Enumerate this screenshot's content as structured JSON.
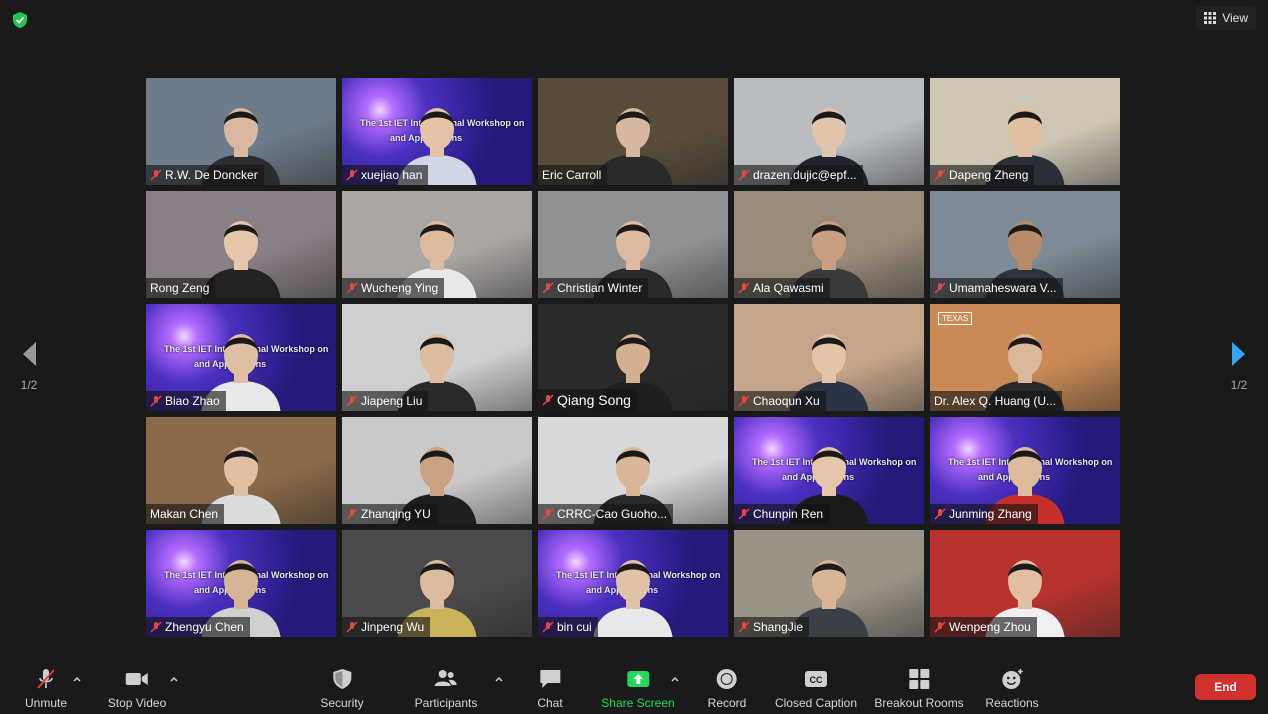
{
  "top_bar": {
    "view_label": "View"
  },
  "participants": [
    {
      "name": "R.W. De Doncker",
      "muted": true,
      "bg": "#6e7b8a",
      "skin": "#d9b8a2",
      "shirt": "#2c2c2c",
      "slide": false
    },
    {
      "name": "xuejiao han",
      "muted": true,
      "bg": "#3a2f8a",
      "skin": "#e3c2a8",
      "shirt": "#cfd7e6",
      "slide": true
    },
    {
      "name": "Eric Carroll",
      "muted": false,
      "bg": "#5a4c3a",
      "skin": "#d6b79f",
      "shirt": "#2a2a2a",
      "slide": false
    },
    {
      "name": "drazen.dujic@epf...",
      "muted": true,
      "bg": "#b9bcc0",
      "skin": "#e2c4ad",
      "shirt": "#1f2430",
      "slide": false
    },
    {
      "name": "Dapeng Zheng",
      "muted": true,
      "bg": "#cfc6b3",
      "skin": "#e0bfa0",
      "shirt": "#2b2f3a",
      "slide": false
    },
    {
      "name": "Rong Zeng",
      "muted": false,
      "bg": "#8a7f86",
      "skin": "#e6c6aa",
      "shirt": "#222222",
      "slide": false,
      "active": true
    },
    {
      "name": "Wucheng Ying",
      "muted": true,
      "bg": "#a9a6a4",
      "skin": "#dcbb9f",
      "shirt": "#e8e8e8",
      "slide": false
    },
    {
      "name": "Christian Winter",
      "muted": true,
      "bg": "#8f9193",
      "skin": "#ddbba0",
      "shirt": "#2a2a2a",
      "slide": false
    },
    {
      "name": "Ala Qawasmi",
      "muted": true,
      "bg": "#9a8a7a",
      "skin": "#c99f82",
      "shirt": "#3a3a3a",
      "slide": false
    },
    {
      "name": "Umamaheswara V...",
      "muted": true,
      "bg": "#7e8b96",
      "skin": "#b88c6a",
      "shirt": "#2b3240",
      "slide": false
    },
    {
      "name": "Biao Zhao",
      "muted": true,
      "bg": "#3a2f8a",
      "skin": "#dfbfa3",
      "shirt": "#e8e8e8",
      "slide": true
    },
    {
      "name": "Jiapeng Liu",
      "muted": true,
      "bg": "#cfcfcf",
      "skin": "#dcbca0",
      "shirt": "#2a2a2a",
      "slide": false
    },
    {
      "name": "Qiang Song",
      "muted": true,
      "bg": "#2a2a2a",
      "skin": "#d2b090",
      "shirt": "#1f1f1f",
      "slide": false,
      "big": true
    },
    {
      "name": "Chaoqun Xu",
      "muted": true,
      "bg": "#c4a58a",
      "skin": "#e4c4a8",
      "shirt": "#2a3444",
      "slide": false
    },
    {
      "name": "Dr. Alex Q. Huang (U...",
      "muted": false,
      "bg": "#c98a56",
      "skin": "#dcb89a",
      "shirt": "#2a2a2a",
      "slide": false,
      "texas": "TEXAS"
    },
    {
      "name": "Makan Chen",
      "muted": false,
      "bg": "#8a6a4a",
      "skin": "#e0bfa2",
      "shirt": "#dcdcdc",
      "slide": false
    },
    {
      "name": "Zhanqing YU",
      "muted": true,
      "bg": "#c9c9c9",
      "skin": "#caa282",
      "shirt": "#1f1f1f",
      "slide": false
    },
    {
      "name": "CRRC-Cao Guoho...",
      "muted": true,
      "bg": "#d8d8d8",
      "skin": "#d8b798",
      "shirt": "#2a2a2a",
      "slide": false
    },
    {
      "name": "Chunpin Ren",
      "muted": true,
      "bg": "#3a2f8a",
      "skin": "#e6c6ab",
      "shirt": "#1a1a1a",
      "slide": true
    },
    {
      "name": "Junming Zhang",
      "muted": true,
      "bg": "#3a2f8a",
      "skin": "#dcba9c",
      "shirt": "#c8302e",
      "slide": true
    },
    {
      "name": "Zhengyu Chen",
      "muted": true,
      "bg": "#3a2f8a",
      "skin": "#d6b597",
      "shirt": "#cfcfcf",
      "slide": true
    },
    {
      "name": "Jinpeng Wu",
      "muted": true,
      "bg": "#4a4a4a",
      "skin": "#dbbb9d",
      "shirt": "#c9b25a",
      "slide": false
    },
    {
      "name": "bin cui",
      "muted": true,
      "bg": "#3a2f8a",
      "skin": "#e2c2a6",
      "shirt": "#e8e8e8",
      "slide": true
    },
    {
      "name": "ShangJie",
      "muted": true,
      "bg": "#9a9386",
      "skin": "#d8b597",
      "shirt": "#3a3f48",
      "slide": false
    },
    {
      "name": "Wenpeng Zhou",
      "muted": true,
      "bg": "#b8332e",
      "skin": "#e0bfa2",
      "shirt": "#f0f0f0",
      "slide": false
    }
  ],
  "slide_text": {
    "line1": "The 1st IET International Workshop on",
    "line2": "and Applications"
  },
  "pager": {
    "left_label": "1/2",
    "right_label": "1/2"
  },
  "toolbar": {
    "unmute": "Unmute",
    "stop_video": "Stop Video",
    "security": "Security",
    "participants": "Participants",
    "chat": "Chat",
    "share_screen": "Share Screen",
    "record": "Record",
    "closed_caption": "Closed Caption",
    "breakout_rooms": "Breakout Rooms",
    "reactions": "Reactions",
    "end": "End"
  },
  "colors": {
    "share_green": "#23d959",
    "end_red": "#d0312d",
    "active_speaker": "#e6e86a"
  }
}
